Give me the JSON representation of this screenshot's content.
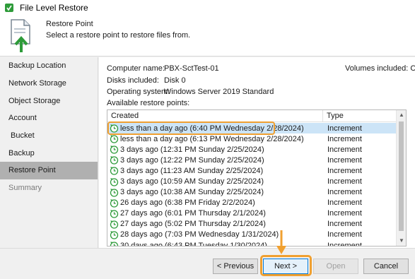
{
  "window": {
    "title": "File Level Restore",
    "title_icon": "veeam-icon"
  },
  "header": {
    "title": "Restore Point",
    "subtitle": "Select a restore point to restore files from.",
    "icon": "restore-document-icon"
  },
  "sidebar": {
    "items": [
      {
        "label": "Backup Location",
        "state": "normal"
      },
      {
        "label": "Network Storage",
        "state": "normal"
      },
      {
        "label": "Object Storage",
        "state": "normal"
      },
      {
        "label": "Account",
        "state": "normal"
      },
      {
        "label": "Bucket",
        "state": "normal"
      },
      {
        "label": "Backup",
        "state": "normal"
      },
      {
        "label": "Restore Point",
        "state": "active"
      },
      {
        "label": "Summary",
        "state": "disabled"
      }
    ]
  },
  "details": {
    "computer_name_label": "Computer name:",
    "computer_name": "PBX-SctTest-01",
    "disks_label": "Disks included:",
    "disks": "Disk 0",
    "os_label": "Operating system:",
    "os": "Windows Server 2019 Standard",
    "volumes_label": "Volumes included:",
    "volumes": "C",
    "available_label": "Available restore points:"
  },
  "table": {
    "columns": [
      "Created",
      "Type"
    ],
    "rows": [
      {
        "created": "less than a day ago (6:40 PM Wednesday 2/28/2024)",
        "type": "Increment",
        "selected": true
      },
      {
        "created": "less than a day ago (6:13 PM Wednesday 2/28/2024)",
        "type": "Increment"
      },
      {
        "created": "3 days ago (12:31 PM Sunday 2/25/2024)",
        "type": "Increment"
      },
      {
        "created": "3 days ago (12:22 PM Sunday 2/25/2024)",
        "type": "Increment"
      },
      {
        "created": "3 days ago (11:23 AM Sunday 2/25/2024)",
        "type": "Increment"
      },
      {
        "created": "3 days ago (10:59 AM Sunday 2/25/2024)",
        "type": "Increment"
      },
      {
        "created": "3 days ago (10:38 AM Sunday 2/25/2024)",
        "type": "Increment"
      },
      {
        "created": "26 days ago (6:38 PM Friday 2/2/2024)",
        "type": "Increment"
      },
      {
        "created": "27 days ago (6:01 PM Thursday 2/1/2024)",
        "type": "Increment"
      },
      {
        "created": "27 days ago (5:02 PM Thursday 2/1/2024)",
        "type": "Increment"
      },
      {
        "created": "28 days ago (7:03 PM Wednesday 1/31/2024)",
        "type": "Increment"
      },
      {
        "created": "30 days ago (6:43 PM Tuesday 1/30/2024)",
        "type": "Increment"
      }
    ]
  },
  "buttons": {
    "previous": "< Previous",
    "next": "Next >",
    "open": "Open",
    "cancel": "Cancel"
  },
  "colors": {
    "highlight": "#f0a030",
    "selected_row": "#cce4f7",
    "icon_green": "#2e9b3a"
  }
}
